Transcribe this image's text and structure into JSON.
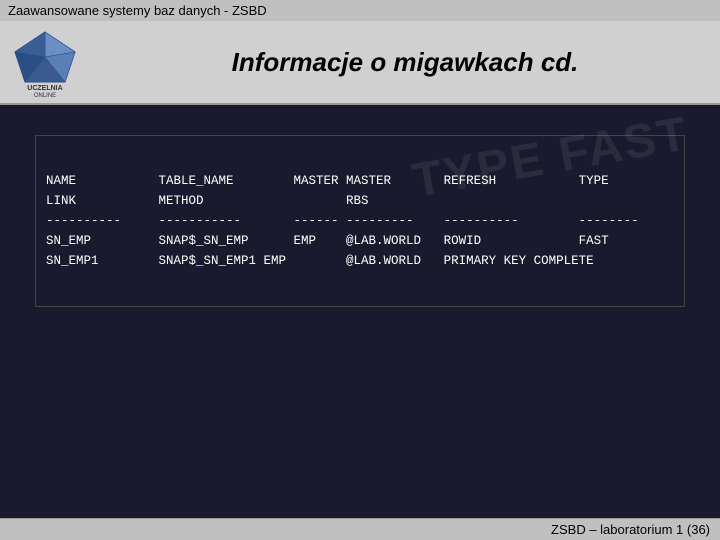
{
  "topbar": {
    "title": "Zaawansowane systemy baz danych - ZSBD"
  },
  "header": {
    "title": "Informacje o migawkach cd."
  },
  "footer": {
    "text": "ZSBD – laboratorium 1 (36)"
  },
  "code": {
    "lines": [
      "NAME           TABLE_NAME        MASTER MASTER       REFRESH           TYPE",
      "LINK           METHOD                   RBS",
      "----------     -----------       ------ ---------    ----------        --------",
      "SN_EMP         SNAP$_SN_EMP      EMP    @LAB.WORLD   ROWID             FAST",
      "SN_EMP1        SNAP$_SN_EMP1 EMP        @LAB.WORLD   PRIMARY KEY COMPLETE"
    ]
  },
  "overlay": {
    "text": "TYPE FAST"
  }
}
